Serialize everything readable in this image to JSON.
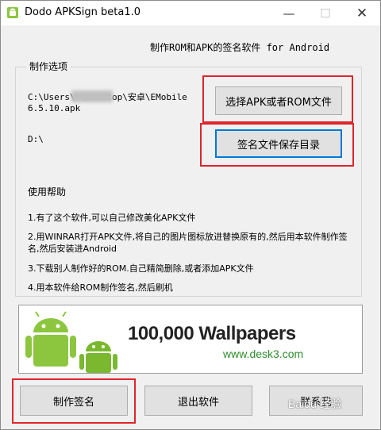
{
  "window": {
    "title": "Dodo APKSign beta1.0",
    "controls": {
      "minimize": "—",
      "maximize": "☐",
      "close": "✕"
    }
  },
  "header": {
    "subtitle": "制作ROM和APK的签名软件 for Android"
  },
  "options": {
    "group_label": "制作选项",
    "apk_path": "C:\\Users\\        \\Desktop\\安卓\\EMobile6.5.10.apk",
    "select_apk_button": "选择APK或者ROM文件",
    "sign_path": "D:\\",
    "save_dir_button": "签名文件保存目录"
  },
  "help": {
    "title": "使用帮助",
    "items": [
      "1.有了这个软件,可以自己修改美化APK文件",
      "2.用WINRAR打开APK文件,将自己的图片图标放进替换原有的,然后用本软件制作签名,然后安装进Android",
      "3.下载别人制作好的ROM.自己精简删除,或者添加APK文件",
      "4.用本软件给ROM制作签名,然后刷机"
    ]
  },
  "banner": {
    "title": "100,000 Wallpapers",
    "url": "www.desk3.com"
  },
  "footer": {
    "make_sign": "制作签名",
    "exit": "退出软件",
    "about": "联系我"
  },
  "watermark": "Baidu 经验",
  "colors": {
    "highlight": "#e0242b",
    "focus": "#0078d7",
    "android_green": "#8cc63f"
  }
}
